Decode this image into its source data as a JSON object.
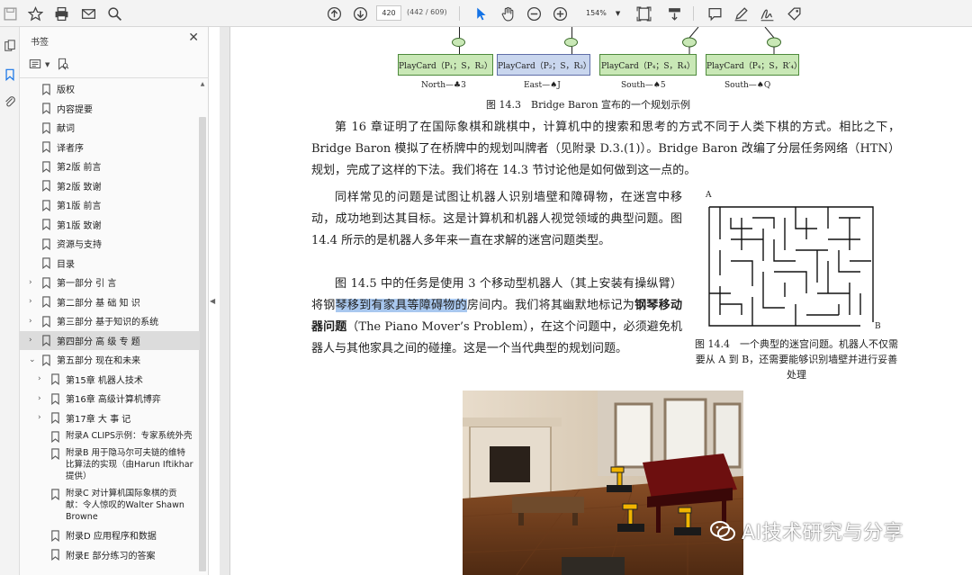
{
  "toolbar": {
    "page_current": "420",
    "page_count": "(442 / 609)",
    "zoom": "154%"
  },
  "bookmarks_panel": {
    "title": "书签",
    "items": [
      {
        "label": "版权",
        "level": 1,
        "expandable": false,
        "selected": false
      },
      {
        "label": "内容提要",
        "level": 1,
        "expandable": false,
        "selected": false
      },
      {
        "label": "献词",
        "level": 1,
        "expandable": false,
        "selected": false
      },
      {
        "label": "译者序",
        "level": 1,
        "expandable": false,
        "selected": false
      },
      {
        "label": "第2版 前言",
        "level": 1,
        "expandable": false,
        "selected": false
      },
      {
        "label": "第2版 致谢",
        "level": 1,
        "expandable": false,
        "selected": false
      },
      {
        "label": "第1版 前言",
        "level": 1,
        "expandable": false,
        "selected": false
      },
      {
        "label": "第1版 致谢",
        "level": 1,
        "expandable": false,
        "selected": false
      },
      {
        "label": "资源与支持",
        "level": 1,
        "expandable": false,
        "selected": false
      },
      {
        "label": "目录",
        "level": 1,
        "expandable": false,
        "selected": false
      },
      {
        "label": "第一部分 引 言",
        "level": 1,
        "expandable": true,
        "expanded": false,
        "selected": false
      },
      {
        "label": "第二部分 基 础 知 识",
        "level": 1,
        "expandable": true,
        "expanded": false,
        "selected": false
      },
      {
        "label": "第三部分 基于知识的系统",
        "level": 1,
        "expandable": true,
        "expanded": false,
        "selected": false
      },
      {
        "label": "第四部分 高 级 专 题",
        "level": 1,
        "expandable": true,
        "expanded": false,
        "selected": true
      },
      {
        "label": "第五部分 现在和未来",
        "level": 1,
        "expandable": true,
        "expanded": true,
        "selected": false
      },
      {
        "label": "第15章 机器人技术",
        "level": 2,
        "expandable": true,
        "expanded": false,
        "selected": false
      },
      {
        "label": "第16章 高级计算机博弈",
        "level": 2,
        "expandable": true,
        "expanded": false,
        "selected": false
      },
      {
        "label": "第17章 大 事 记",
        "level": 2,
        "expandable": true,
        "expanded": false,
        "selected": false
      },
      {
        "label": "附录A CLIPS示例：专家系统外壳",
        "level": 2,
        "expandable": false,
        "selected": false
      },
      {
        "label": "附录B 用于隐马尔可夫链的维特比算法的实现（由Harun Iftikhar提供）",
        "level": 2,
        "expandable": false,
        "selected": false
      },
      {
        "label": "附录C 对计算机国际象棋的贡献：令人惊叹的Walter Shawn Browne",
        "level": 2,
        "expandable": false,
        "selected": false
      },
      {
        "label": "附录D 应用程序和数据",
        "level": 2,
        "expandable": false,
        "selected": false
      },
      {
        "label": "附录E 部分练习的答案",
        "level": 2,
        "expandable": false,
        "selected": false
      }
    ]
  },
  "document": {
    "playcards": [
      {
        "label": "PlayCard（P₁；S，R₂）",
        "caption": "North—♣3"
      },
      {
        "label": "PlayCard（P₂；S，R₃）",
        "caption": "East—♠J"
      },
      {
        "label": "PlayCard（P₄；S，R₄）",
        "caption": "South—♠5"
      },
      {
        "label": "PlayCard（P₄；S，R′₄）",
        "caption": "South—♠Q"
      }
    ],
    "figure_caption": "图 14.3　Bridge Baron 宣布的一个规划示例",
    "para1": "第 16 章证明了在国际象棋和跳棋中，计算机中的搜索和思考的方式不同于人类下棋的方式。相比之下，Bridge Baron 模拟了在桥牌中的规划叫牌者（见附录 D.3.(1)）。Bridge Baron 改编了分层任务网络（HTN）规划，完成了这样的下法。我们将在 14.3 节讨论他是如何做到这一点的。",
    "para2": "同样常见的问题是试图让机器人识别墙壁和障碍物，在迷宫中移动，成功地到达其目标。这是计算机和机器人视觉领域的典型问题。图 14.4 所示的是机器人多年来一直在求解的迷宫问题类型。",
    "para3_a": "图 14.5 中的任务是使用 3 个移动型机器人（其上安装有操纵臂）将钢",
    "para3_highlight": "琴移到有家具等障碍物的",
    "para3_b": "房间内。我们将其幽默地标记为",
    "para3_bold": "钢琴移动器问题",
    "para3_c": "（The Piano Mover’s Problem），在这个问题中，必须避免机器人与其他家具之间的碰撞。这是一个当代典型的规划问题。",
    "maze_label_a": "A",
    "maze_label_b": "B",
    "maze_caption": "图 14.4　一个典型的迷宫问题。机器人不仅需要从 A 到 B，还需要能够识别墙壁并进行妥善处理",
    "watermark": "AI技术研究与分享"
  },
  "icons": [
    "save-icon",
    "bookmark-star-icon",
    "print-icon",
    "email-icon",
    "search-icon",
    "page-up-icon",
    "page-down-icon",
    "cursor-icon",
    "hand-icon",
    "zoom-out-icon",
    "zoom-in-icon",
    "fit-page-icon",
    "scroll-mode-icon",
    "comment-icon",
    "pen-icon",
    "sign-icon",
    "stamp-icon",
    "thumbnails-icon",
    "bookmarks-icon",
    "attachments-icon"
  ],
  "colors": {
    "accent": "#1473e6",
    "highlight": "#a9c8ef",
    "playcard_green": "#c9e8b6",
    "playcard_blue": "#c9d6ee"
  }
}
